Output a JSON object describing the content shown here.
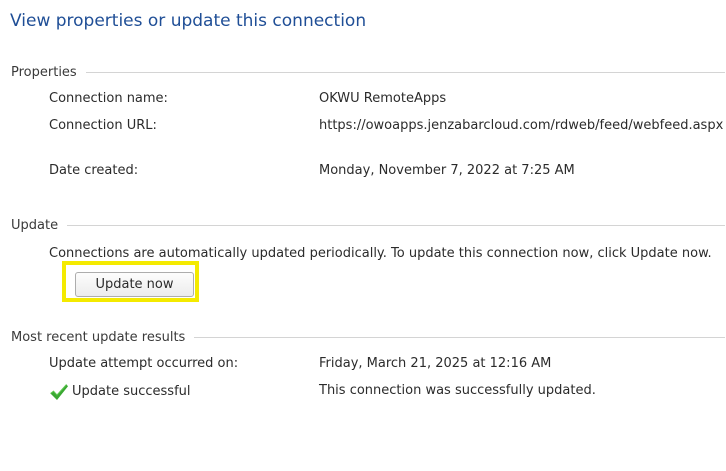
{
  "title": "View properties or update this connection",
  "properties": {
    "header": "Properties",
    "connection_name_label": "Connection name:",
    "connection_name_value": "OKWU RemoteApps",
    "connection_url_label": "Connection URL:",
    "connection_url_value": "https://owoapps.jenzabarcloud.com/rdweb/feed/webfeed.aspx",
    "date_created_label": "Date created:",
    "date_created_value": "Monday, November 7, 2022 at 7:25 AM"
  },
  "update": {
    "header": "Update",
    "description": "Connections are automatically updated periodically.  To update this connection now, click Update now.",
    "button_label": "Update now",
    "highlight_color": "#f4ea00"
  },
  "results": {
    "header": "Most recent update results",
    "attempt_label": "Update attempt occurred on:",
    "attempt_value": "Friday, March 21, 2025 at 12:16 AM",
    "status_icon": "checkmark-icon",
    "status_label": "Update successful",
    "status_message": "This connection was successfully updated.",
    "success_color": "#3aa832"
  },
  "colors": {
    "title": "#1f4e96",
    "text": "#2b2b2b",
    "rule": "#d4d4d4"
  }
}
